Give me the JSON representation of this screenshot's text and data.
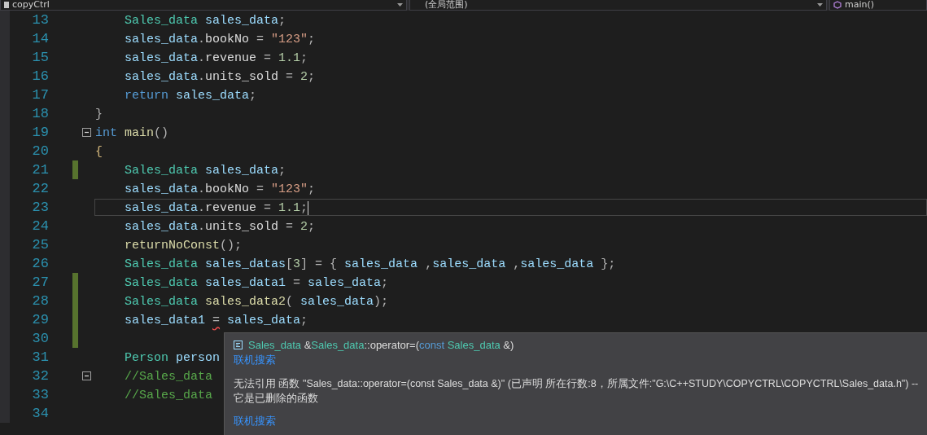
{
  "navigation_bar": {
    "dropdowns": [
      {
        "kind": "project",
        "value": "copyCtrl"
      },
      {
        "kind": "scope",
        "value": "(全局范围)"
      },
      {
        "kind": "member",
        "value": "main()"
      }
    ]
  },
  "editor": {
    "lines": [
      {
        "number": "13",
        "changed": false,
        "current": false,
        "tokens": [
          {
            "kind": "type",
            "text": "    Sales_data"
          },
          {
            "kind": "var",
            "text": " sales_data"
          },
          {
            "kind": "punct",
            "text": ";"
          }
        ]
      },
      {
        "number": "14",
        "changed": false,
        "current": false,
        "tokens": [
          {
            "kind": "var",
            "text": "    sales_data"
          },
          {
            "kind": "punct",
            "text": "."
          },
          {
            "kind": "member",
            "text": "bookNo"
          },
          {
            "kind": "punct",
            "text": " = "
          },
          {
            "kind": "str",
            "text": "\"123\""
          },
          {
            "kind": "punct",
            "text": ";"
          }
        ]
      },
      {
        "number": "15",
        "changed": false,
        "current": false,
        "tokens": [
          {
            "kind": "var",
            "text": "    sales_data"
          },
          {
            "kind": "punct",
            "text": "."
          },
          {
            "kind": "member",
            "text": "revenue"
          },
          {
            "kind": "punct",
            "text": " = "
          },
          {
            "kind": "num",
            "text": "1.1"
          },
          {
            "kind": "punct",
            "text": ";"
          }
        ]
      },
      {
        "number": "16",
        "changed": false,
        "current": false,
        "tokens": [
          {
            "kind": "var",
            "text": "    sales_data"
          },
          {
            "kind": "punct",
            "text": "."
          },
          {
            "kind": "member",
            "text": "units_sold"
          },
          {
            "kind": "punct",
            "text": " = "
          },
          {
            "kind": "num",
            "text": "2"
          },
          {
            "kind": "punct",
            "text": ";"
          }
        ]
      },
      {
        "number": "17",
        "changed": false,
        "current": false,
        "tokens": [
          {
            "kind": "kw",
            "text": "    return"
          },
          {
            "kind": "var",
            "text": " sales_data"
          },
          {
            "kind": "punct",
            "text": ";"
          }
        ]
      },
      {
        "number": "18",
        "changed": false,
        "current": false,
        "tokens": [
          {
            "kind": "punct",
            "text": "}"
          }
        ]
      },
      {
        "number": "19",
        "changed": false,
        "current": false,
        "fold": {
          "expanded": true
        },
        "tokens": [
          {
            "kind": "kw",
            "text": "int"
          },
          {
            "kind": "fn",
            "text": " main"
          },
          {
            "kind": "punct",
            "text": "()"
          }
        ]
      },
      {
        "number": "20",
        "changed": false,
        "current": false,
        "tokens": [
          {
            "kind": "brace",
            "text": "{"
          }
        ]
      },
      {
        "number": "21",
        "changed": true,
        "current": false,
        "tokens": [
          {
            "kind": "type",
            "text": "    Sales_data"
          },
          {
            "kind": "var",
            "text": " sales_data"
          },
          {
            "kind": "punct",
            "text": ";"
          }
        ]
      },
      {
        "number": "22",
        "changed": false,
        "current": false,
        "tokens": [
          {
            "kind": "var",
            "text": "    sales_data"
          },
          {
            "kind": "punct",
            "text": "."
          },
          {
            "kind": "member",
            "text": "bookNo"
          },
          {
            "kind": "punct",
            "text": " = "
          },
          {
            "kind": "str",
            "text": "\"123\""
          },
          {
            "kind": "punct",
            "text": ";"
          }
        ]
      },
      {
        "number": "23",
        "changed": false,
        "current": true,
        "tokens": [
          {
            "kind": "var",
            "text": "    sales_data"
          },
          {
            "kind": "punct",
            "text": "."
          },
          {
            "kind": "member",
            "text": "revenue"
          },
          {
            "kind": "punct",
            "text": " = "
          },
          {
            "kind": "num",
            "text": "1.1"
          },
          {
            "kind": "punct",
            "text": ";"
          }
        ]
      },
      {
        "number": "24",
        "changed": false,
        "current": false,
        "tokens": [
          {
            "kind": "var",
            "text": "    sales_data"
          },
          {
            "kind": "punct",
            "text": "."
          },
          {
            "kind": "member",
            "text": "units_sold"
          },
          {
            "kind": "punct",
            "text": " = "
          },
          {
            "kind": "num",
            "text": "2"
          },
          {
            "kind": "punct",
            "text": ";"
          }
        ]
      },
      {
        "number": "25",
        "changed": false,
        "current": false,
        "tokens": [
          {
            "kind": "fn",
            "text": "    returnNoConst"
          },
          {
            "kind": "punct",
            "text": "();"
          }
        ]
      },
      {
        "number": "26",
        "changed": false,
        "current": false,
        "tokens": [
          {
            "kind": "type",
            "text": "    Sales_data"
          },
          {
            "kind": "var",
            "text": " sales_datas"
          },
          {
            "kind": "punct",
            "text": "["
          },
          {
            "kind": "num",
            "text": "3"
          },
          {
            "kind": "punct",
            "text": "] = { "
          },
          {
            "kind": "var",
            "text": "sales_data"
          },
          {
            "kind": "punct",
            "text": " ,"
          },
          {
            "kind": "var",
            "text": "sales_data"
          },
          {
            "kind": "punct",
            "text": " ,"
          },
          {
            "kind": "var",
            "text": "sales_data"
          },
          {
            "kind": "punct",
            "text": " };"
          }
        ]
      },
      {
        "number": "27",
        "changed": true,
        "current": false,
        "tokens": [
          {
            "kind": "type",
            "text": "    Sales_data"
          },
          {
            "kind": "var",
            "text": " sales_data1"
          },
          {
            "kind": "punct",
            "text": " = "
          },
          {
            "kind": "var",
            "text": "sales_data"
          },
          {
            "kind": "punct",
            "text": ";"
          }
        ]
      },
      {
        "number": "28",
        "changed": true,
        "current": false,
        "tokens": [
          {
            "kind": "type",
            "text": "    Sales_data"
          },
          {
            "kind": "fn",
            "text": " sales_data2"
          },
          {
            "kind": "punct",
            "text": "( "
          },
          {
            "kind": "var",
            "text": "sales_data"
          },
          {
            "kind": "punct",
            "text": ");"
          }
        ]
      },
      {
        "number": "29",
        "changed": true,
        "current": false,
        "tokens": [
          {
            "kind": "var",
            "text": "    sales_data1 "
          },
          {
            "kind": "error",
            "text": "="
          },
          {
            "kind": "var",
            "text": " sales_data"
          },
          {
            "kind": "punct",
            "text": ";"
          }
        ]
      },
      {
        "number": "30",
        "changed": true,
        "current": false
      },
      {
        "number": "31",
        "changed": false,
        "current": false,
        "tokens": [
          {
            "kind": "type",
            "text": "    Person"
          },
          {
            "kind": "var",
            "text": " person"
          }
        ]
      },
      {
        "number": "32",
        "changed": false,
        "current": false,
        "fold": {
          "expanded": true
        },
        "tokens": [
          {
            "kind": "comment",
            "text": "    //Sales_data"
          }
        ]
      },
      {
        "number": "33",
        "changed": false,
        "current": false,
        "tokens": [
          {
            "kind": "comment",
            "text": "    //Sales_data"
          }
        ]
      },
      {
        "number": "34",
        "changed": false,
        "current": false
      }
    ]
  },
  "quick_info": {
    "signature": [
      {
        "kind": "type",
        "text": "Sales_data"
      },
      {
        "kind": "plain",
        "text": " &"
      },
      {
        "kind": "type",
        "text": "Sales_data"
      },
      {
        "kind": "plain",
        "text": "::operator=("
      },
      {
        "kind": "kw",
        "text": "const"
      },
      {
        "kind": "type",
        "text": " Sales_data"
      },
      {
        "kind": "plain",
        "text": " &)"
      }
    ],
    "links": [
      "联机搜索",
      "联机搜索"
    ],
    "message": "无法引用 函数 \"Sales_data::operator=(const Sales_data &)\" (已声明 所在行数:8，所属文件:\"G:\\C++STUDY\\COPYCTRL\\COPYCTRL\\Sales_data.h\") -- 它是已删除的函数"
  }
}
